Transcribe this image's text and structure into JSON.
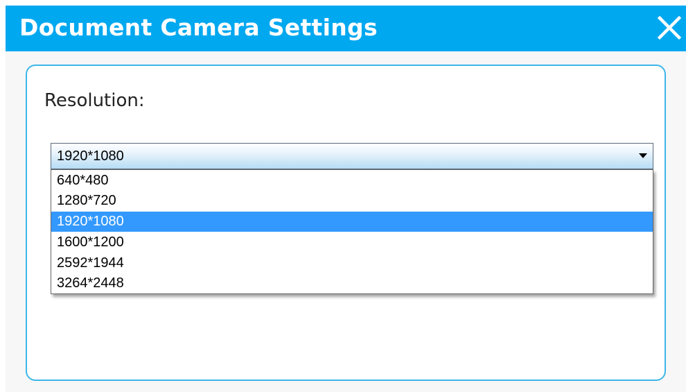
{
  "window": {
    "title": "Document Camera Settings",
    "close_icon": "close-icon",
    "accent_color": "#00a8f0"
  },
  "resolution": {
    "label": "Resolution:",
    "selected_value": "1920*1080",
    "options": [
      "640*480",
      "1280*720",
      "1920*1080",
      "1600*1200",
      "2592*1944",
      "3264*2448"
    ],
    "highlighted_option": "1920*1080",
    "dropdown_icon": "chevron-down-icon",
    "highlight_color": "#3399ff"
  }
}
